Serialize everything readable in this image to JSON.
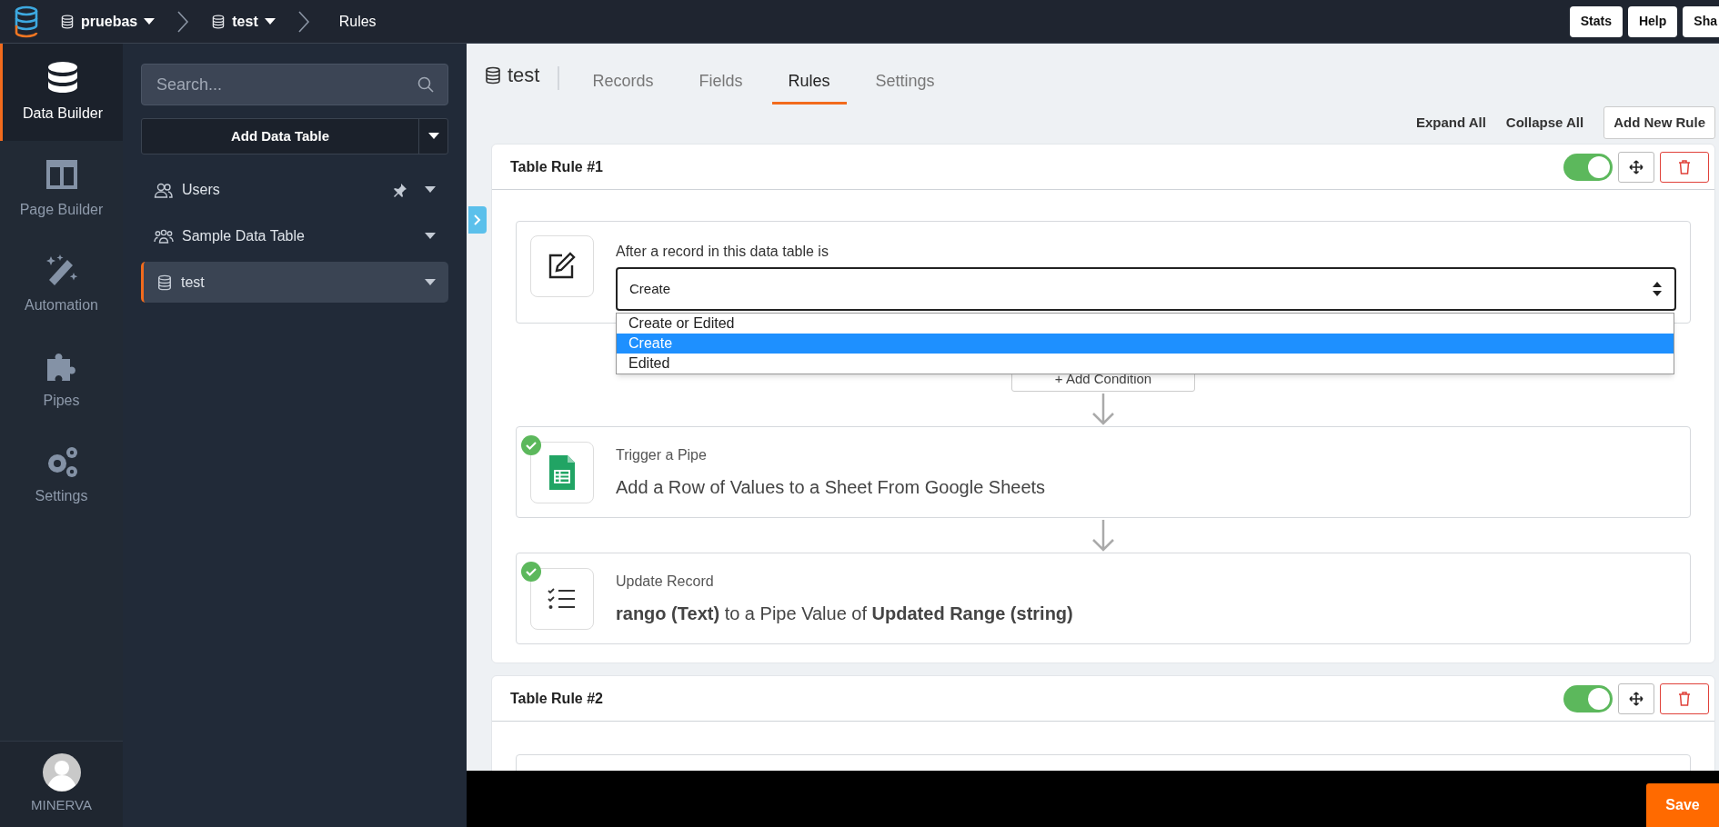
{
  "top_bar": {
    "breadcrumbs": [
      {
        "label": "pruebas",
        "kind": "dropdown"
      },
      {
        "label": "test",
        "kind": "dropdown"
      },
      {
        "label": "Rules",
        "kind": "current"
      }
    ],
    "buttons": [
      "Stats",
      "Help",
      "Sha"
    ]
  },
  "nav": {
    "items": [
      {
        "label": "Data Builder",
        "selected": true
      },
      {
        "label": "Page Builder",
        "selected": false
      },
      {
        "label": "Automation",
        "selected": false
      },
      {
        "label": "Pipes",
        "selected": false
      },
      {
        "label": "Settings",
        "selected": false
      }
    ],
    "user": {
      "name": "MINERVA"
    }
  },
  "tables_panel": {
    "search": {
      "placeholder": "Search..."
    },
    "add_button": "Add Data Table",
    "items": [
      {
        "label": "Users",
        "selected": false,
        "pinned": true
      },
      {
        "label": "Sample Data Table",
        "selected": false,
        "pinned": false
      },
      {
        "label": "test",
        "selected": true,
        "pinned": false
      }
    ]
  },
  "main": {
    "table_name": "test",
    "tabs": [
      {
        "label": "Records",
        "selected": false
      },
      {
        "label": "Fields",
        "selected": false
      },
      {
        "label": "Rules",
        "selected": true
      },
      {
        "label": "Settings",
        "selected": false
      }
    ],
    "actions": [
      {
        "label": "Expand All",
        "kind": "link"
      },
      {
        "label": "Collapse All",
        "kind": "link"
      },
      {
        "label": "Add New Rule",
        "kind": "button"
      }
    ],
    "rules": [
      {
        "title": "Table Rule #1",
        "enabled": true,
        "trigger": {
          "label": "After a record in this data table is",
          "value": "Create",
          "expanded": true,
          "options": [
            {
              "label": "Create or Edited",
              "selected": false
            },
            {
              "label": "Create",
              "selected": true
            },
            {
              "label": "Edited",
              "selected": false
            }
          ]
        },
        "add_condition": "+ Add Condition",
        "steps": [
          {
            "kind": "pipe",
            "title": "Trigger a Pipe",
            "description": "Add a Row of Values to a Sheet From Google Sheets",
            "done": true
          },
          {
            "kind": "update",
            "title": "Update Record",
            "description": "**rango (Text)** to a Pipe Value of **Updated Range (string)**",
            "done": true
          }
        ]
      },
      {
        "title": "Table Rule #2",
        "enabled": true
      }
    ]
  },
  "save_button": "Save"
}
